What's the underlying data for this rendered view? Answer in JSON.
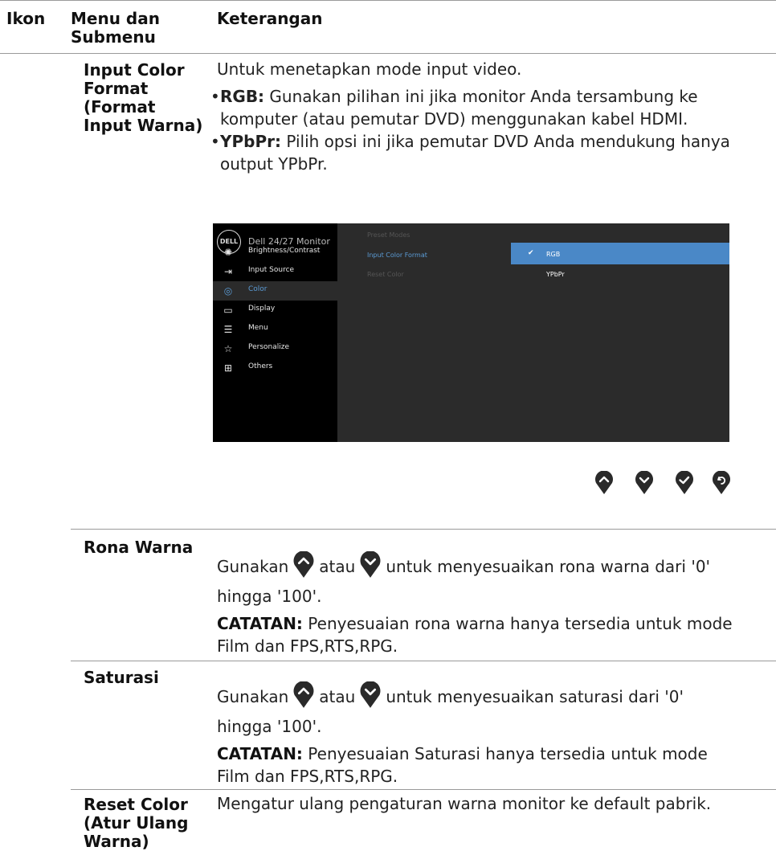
{
  "header": {
    "col_icon": "Ikon",
    "col_menu_line1": "Menu dan",
    "col_menu_line2": "Submenu",
    "col_desc": "Keterangan"
  },
  "input_color_format": {
    "title_lines": [
      "Input Color",
      "Format",
      "(Format",
      "Input Warna)"
    ],
    "intro": "Untuk menetapkan mode input video.",
    "rgb_term": "RGB:",
    "rgb_line1": " Gunakan pilihan ini jika monitor Anda tersambung ke",
    "rgb_line2": "komputer (atau pemutar DVD) menggunakan kabel HDMI.",
    "ypbpr_term": "YPbPr:",
    "ypbpr_line1": " Pilih opsi ini jika pemutar DVD Anda mendukung hanya",
    "ypbpr_line2": "output YPbPr."
  },
  "osd": {
    "logo": "DELL",
    "title": "Dell 24/27 Monitor",
    "menu": [
      {
        "label": "Brightness/Contrast",
        "icon": "brightness-icon"
      },
      {
        "label": "Input Source",
        "icon": "input-source-icon"
      },
      {
        "label": "Color",
        "icon": "color-icon",
        "selected": true
      },
      {
        "label": "Display",
        "icon": "display-icon"
      },
      {
        "label": "Menu",
        "icon": "menu-icon"
      },
      {
        "label": "Personalize",
        "icon": "star-icon"
      },
      {
        "label": "Others",
        "icon": "others-icon"
      }
    ],
    "sub": [
      "Preset Modes",
      "Input Color Format",
      "Reset Color"
    ],
    "options": [
      "RGB",
      "YPbPr"
    ],
    "selected_option": "RGB",
    "colors": {
      "highlight": "#4a88c7",
      "accent_text": "#5b9bd5"
    }
  },
  "nav_buttons": [
    "up-button-icon",
    "down-button-icon",
    "check-button-icon",
    "back-button-icon"
  ],
  "rona": {
    "title": "Rona Warna",
    "line1_a": "Gunakan",
    "line1_b": "atau",
    "line1_c": "untuk menyesuaikan rona warna dari '0'",
    "line2": "hingga '100'.",
    "note_term": "CATATAN:",
    "note_line1": " Penyesuaian rona warna hanya tersedia untuk mode",
    "note_line2": "Film dan FPS,RTS,RPG."
  },
  "saturasi": {
    "title": "Saturasi",
    "line1_a": "Gunakan",
    "line1_b": "atau",
    "line1_c": "untuk menyesuaikan saturasi dari '0'",
    "line2": "hingga '100'.",
    "note_term": "CATATAN:",
    "note_line1": " Penyesuaian Saturasi hanya tersedia untuk mode",
    "note_line2": "Film dan FPS,RTS,RPG."
  },
  "reset_color": {
    "title_lines": [
      "Reset Color",
      "(Atur Ulang",
      "Warna)"
    ],
    "desc": "Mengatur ulang pengaturan warna monitor ke default pabrik."
  }
}
